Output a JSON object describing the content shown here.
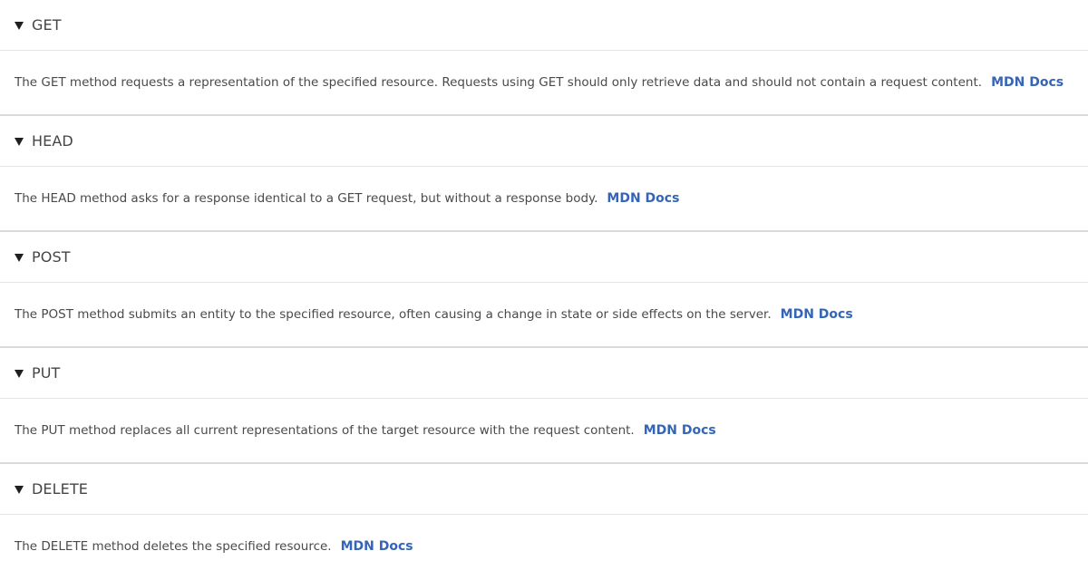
{
  "colors": {
    "link": "#3565b8",
    "text": "#4a4a4a",
    "divider": "#d9d9d9",
    "inner_divider": "#e3e3e3"
  },
  "methods": [
    {
      "name": "GET",
      "description": "The GET method requests a representation of the specified resource. Requests using GET should only retrieve data and should not contain a request content.",
      "link_label": "MDN Docs",
      "toggle_icon": "triangle-down-icon"
    },
    {
      "name": "HEAD",
      "description": "The HEAD method asks for a response identical to a GET request, but without a response body.",
      "link_label": "MDN Docs",
      "toggle_icon": "triangle-down-icon"
    },
    {
      "name": "POST",
      "description": "The POST method submits an entity to the specified resource, often causing a change in state or side effects on the server.",
      "link_label": "MDN Docs",
      "toggle_icon": "triangle-down-icon"
    },
    {
      "name": "PUT",
      "description": "The PUT method replaces all current representations of the target resource with the request content.",
      "link_label": "MDN Docs",
      "toggle_icon": "triangle-down-icon"
    },
    {
      "name": "DELETE",
      "description": "The DELETE method deletes the specified resource.",
      "link_label": "MDN Docs",
      "toggle_icon": "triangle-down-icon"
    }
  ]
}
